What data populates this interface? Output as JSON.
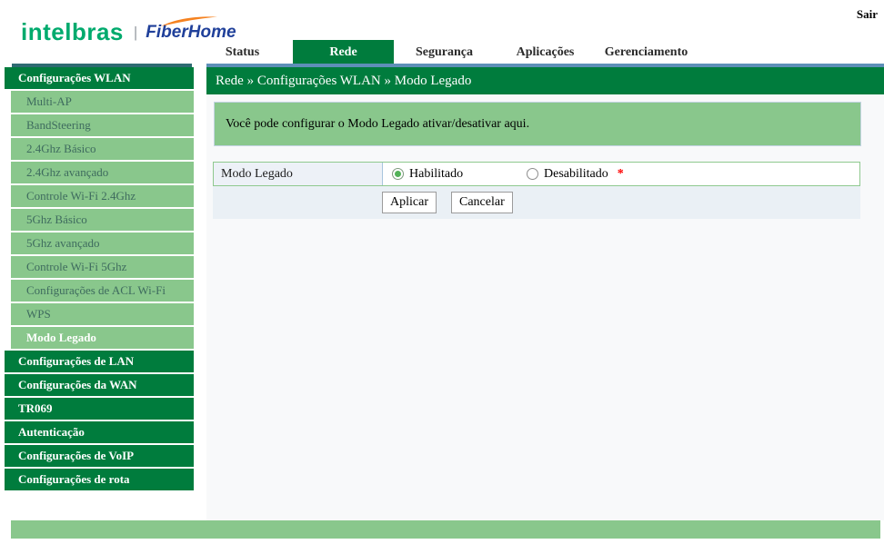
{
  "header": {
    "logout_label": "Sair",
    "brand": {
      "name": "intelbras",
      "divider": "|",
      "partner": "FiberHome"
    },
    "tabs": [
      {
        "label": "Status",
        "active": false
      },
      {
        "label": "Rede",
        "active": true
      },
      {
        "label": "Segurança",
        "active": false
      },
      {
        "label": "Aplicações",
        "active": false
      },
      {
        "label": "Gerenciamento",
        "active": false
      }
    ]
  },
  "breadcrumb": {
    "text": "Rede » Configurações WLAN » Modo Legado"
  },
  "sidebar": {
    "items": [
      {
        "label": "Configurações WLAN",
        "type": "section"
      },
      {
        "label": "Multi-AP",
        "type": "sub"
      },
      {
        "label": "BandSteering",
        "type": "sub"
      },
      {
        "label": "2.4Ghz Básico",
        "type": "sub"
      },
      {
        "label": "2.4Ghz avançado",
        "type": "sub"
      },
      {
        "label": "Controle Wi-Fi 2.4Ghz",
        "type": "sub"
      },
      {
        "label": "5Ghz Básico",
        "type": "sub"
      },
      {
        "label": "5Ghz avançado",
        "type": "sub"
      },
      {
        "label": "Controle Wi-Fi 5Ghz",
        "type": "sub"
      },
      {
        "label": "Configurações de ACL Wi-Fi",
        "type": "sub"
      },
      {
        "label": "WPS",
        "type": "sub"
      },
      {
        "label": "Modo Legado",
        "type": "sub",
        "selected": true
      },
      {
        "label": "Configurações de LAN",
        "type": "section"
      },
      {
        "label": "Configurações da WAN",
        "type": "section"
      },
      {
        "label": "TR069",
        "type": "section"
      },
      {
        "label": "Autenticação",
        "type": "section"
      },
      {
        "label": "Configurações de VoIP",
        "type": "section"
      },
      {
        "label": "Configurações de rota",
        "type": "section"
      }
    ]
  },
  "main": {
    "info_message": "Você pode configurar o Modo Legado ativar/desativar aqui.",
    "form": {
      "field_label": "Modo Legado",
      "options": [
        {
          "label": "Habilitado",
          "selected": true
        },
        {
          "label": "Desabilitado",
          "selected": false
        }
      ],
      "required_marker": "*"
    },
    "actions": [
      {
        "label": "Aplicar"
      },
      {
        "label": "Cancelar"
      }
    ]
  },
  "colors": {
    "dark_green": "#007C3D",
    "light_green": "#89C78C",
    "sidebar_accent_teal": "#2F6B72",
    "main_accent_blue": "#5E8FB8",
    "brand_green": "#00AA6D",
    "partner_blue": "#20409A",
    "swoosh_orange": "#F58220",
    "radio_selected_green": "#53B258",
    "required_red": "#FF0000",
    "label_cell_bg": "#EDF1F7",
    "actions_row_bg": "#EAF0F5"
  }
}
